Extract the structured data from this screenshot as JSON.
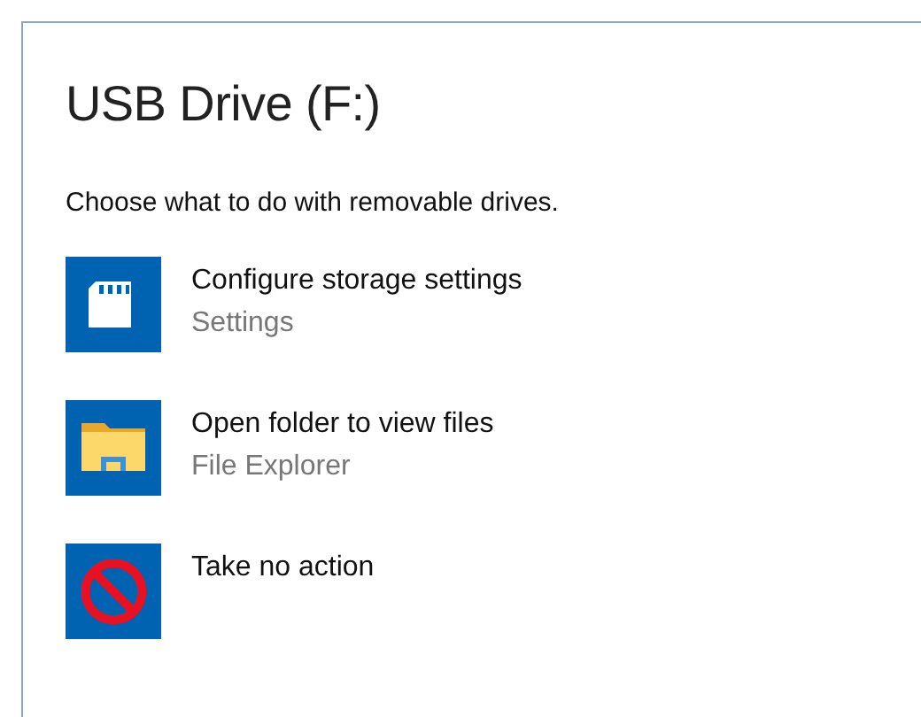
{
  "window": {
    "title": "USB Drive (F:)"
  },
  "prompt": "Choose what to do with removable drives.",
  "options": [
    {
      "kind": "storage",
      "label": "Configure storage settings",
      "app": "Settings"
    },
    {
      "kind": "folder",
      "label": "Open folder to view files",
      "app": "File Explorer"
    },
    {
      "kind": "none",
      "label": "Take no action"
    }
  ]
}
